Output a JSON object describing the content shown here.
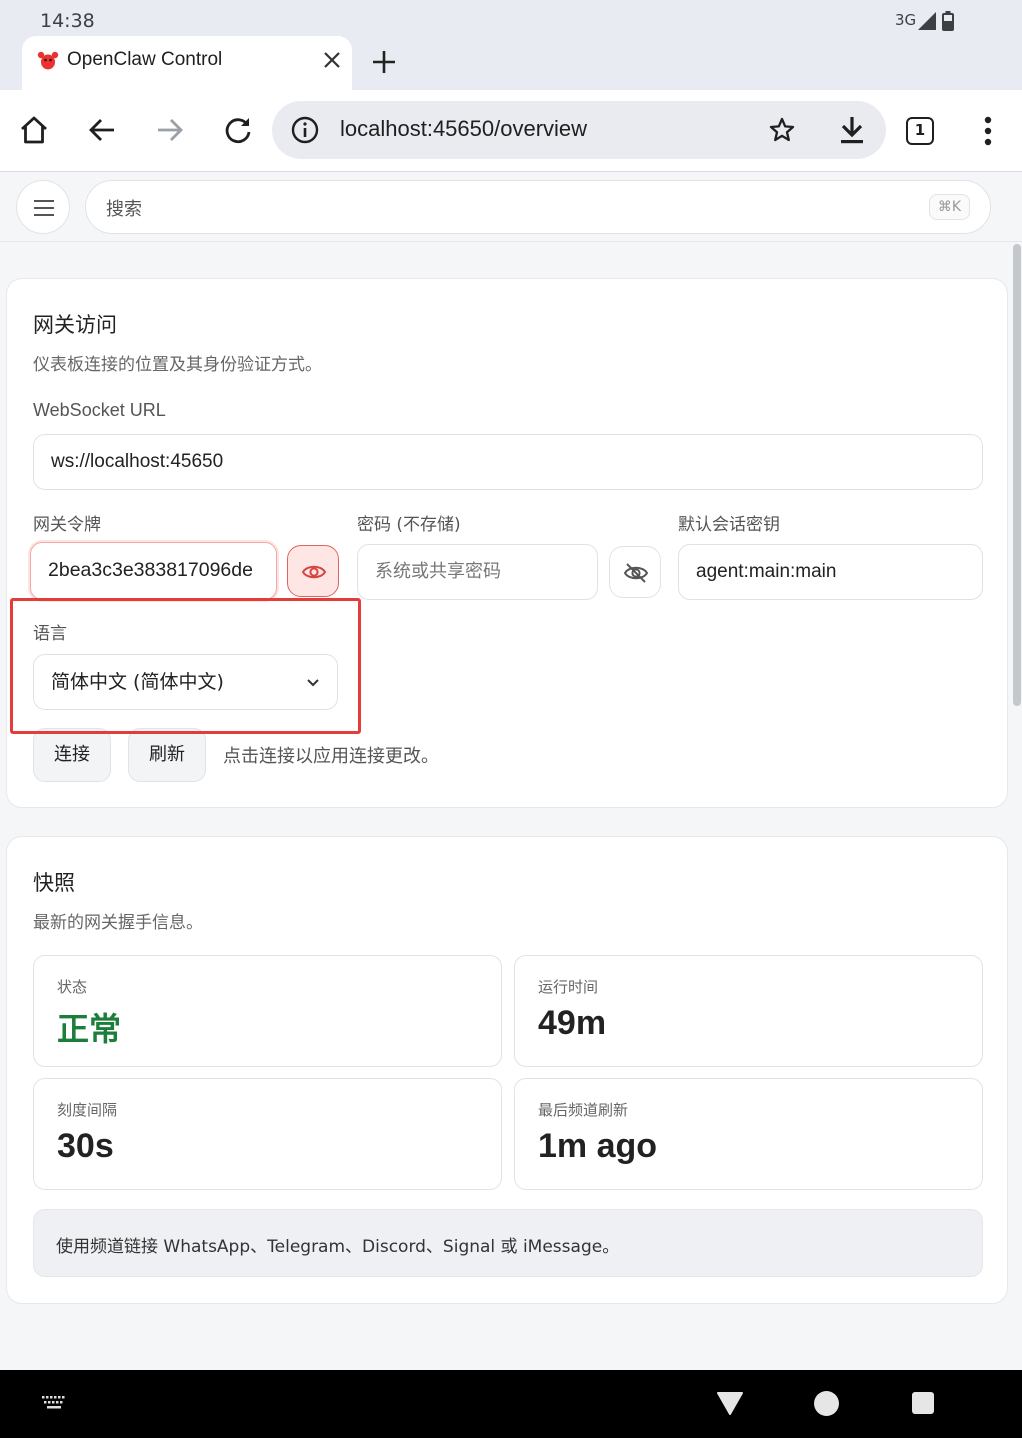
{
  "status": {
    "time": "14:38",
    "network": "3G"
  },
  "tab": {
    "title": "OpenClaw Control"
  },
  "toolbar": {
    "url": "localhost:45650/overview",
    "tab_count": "1"
  },
  "app": {
    "search_placeholder": "搜索",
    "search_shortcut": "⌘K"
  },
  "gateway": {
    "title": "网关访问",
    "subtitle": "仪表板连接的位置及其身份验证方式。",
    "ws_label": "WebSocket URL",
    "ws_value": "ws://localhost:45650",
    "token_label": "网关令牌",
    "token_value": "2bea3c3e383817096de",
    "password_label": "密码 (不存储)",
    "password_placeholder": "系统或共享密码",
    "session_label": "默认会话密钥",
    "session_value": "agent:main:main",
    "language_label": "语言",
    "language_value": "简体中文 (简体中文)",
    "connect_label": "连接",
    "refresh_label": "刷新",
    "hint": "点击连接以应用连接更改。"
  },
  "snapshot": {
    "title": "快照",
    "subtitle": "最新的网关握手信息。",
    "stats": [
      {
        "label": "状态",
        "value": "正常"
      },
      {
        "label": "运行时间",
        "value": "49m"
      },
      {
        "label": "刻度间隔",
        "value": "30s"
      },
      {
        "label": "最后频道刷新",
        "value": "1m ago"
      }
    ],
    "note": "使用频道链接 WhatsApp、Telegram、Discord、Signal 或 iMessage。"
  },
  "colors": {
    "accent": "#e43d39",
    "ok": "#1b7f3b"
  }
}
